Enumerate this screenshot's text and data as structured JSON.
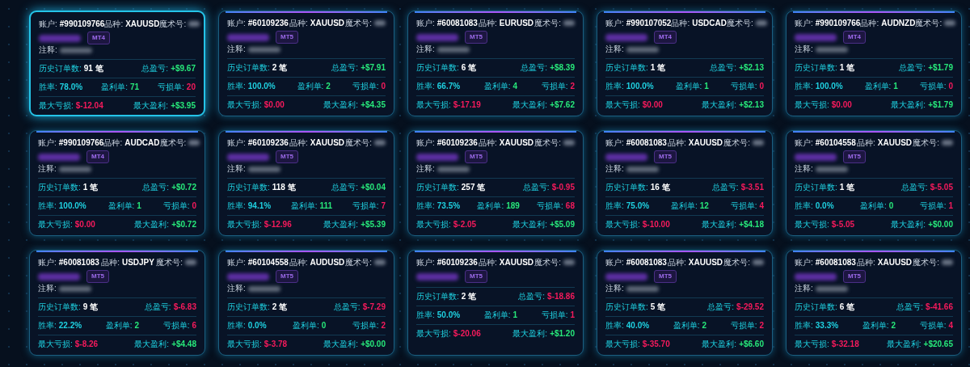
{
  "cards": [
    {
      "selected": true,
      "account": {
        "label": "账户:",
        "value": "#990109766"
      },
      "symbol": {
        "label": "品种:",
        "value": "XAUUSD"
      },
      "magic": {
        "label": "魔术号:"
      },
      "platform": "MT4",
      "comment": {
        "label": "注释:"
      },
      "orders": {
        "label": "历史订单数:",
        "value": "91 笔"
      },
      "total": {
        "label": "总盈亏:",
        "value": "+$9.67",
        "gain": true
      },
      "win_rate": {
        "label": "胜率:",
        "value": "78.0%"
      },
      "wins": {
        "label": "盈利单:",
        "value": "71"
      },
      "losses": {
        "label": "亏损单:",
        "value": "20"
      },
      "max_loss": {
        "label": "最大亏损:",
        "value": "$-12.04"
      },
      "max_profit": {
        "label": "最大盈利:",
        "value": "+$3.95"
      }
    },
    {
      "selected": false,
      "account": {
        "label": "账户:",
        "value": "#60109236"
      },
      "symbol": {
        "label": "品种:",
        "value": "XAUUSD"
      },
      "magic": {
        "label": "魔术号:"
      },
      "platform": "MT5",
      "comment": {
        "label": "注释:"
      },
      "orders": {
        "label": "历史订单数:",
        "value": "2 笔"
      },
      "total": {
        "label": "总盈亏:",
        "value": "+$7.91",
        "gain": true
      },
      "win_rate": {
        "label": "胜率:",
        "value": "100.0%"
      },
      "wins": {
        "label": "盈利单:",
        "value": "2"
      },
      "losses": {
        "label": "亏损单:",
        "value": "0"
      },
      "max_loss": {
        "label": "最大亏损:",
        "value": "$0.00"
      },
      "max_profit": {
        "label": "最大盈利:",
        "value": "+$4.35"
      }
    },
    {
      "selected": false,
      "account": {
        "label": "账户:",
        "value": "#60081083"
      },
      "symbol": {
        "label": "品种:",
        "value": "EURUSD"
      },
      "magic": {
        "label": "魔术号:"
      },
      "platform": "MT5",
      "comment": {
        "label": "注释:"
      },
      "orders": {
        "label": "历史订单数:",
        "value": "6 笔"
      },
      "total": {
        "label": "总盈亏:",
        "value": "+$8.39",
        "gain": true
      },
      "win_rate": {
        "label": "胜率:",
        "value": "66.7%"
      },
      "wins": {
        "label": "盈利单:",
        "value": "4"
      },
      "losses": {
        "label": "亏损单:",
        "value": "2"
      },
      "max_loss": {
        "label": "最大亏损:",
        "value": "$-17.19"
      },
      "max_profit": {
        "label": "最大盈利:",
        "value": "+$7.62"
      }
    },
    {
      "selected": false,
      "account": {
        "label": "账户:",
        "value": "#990107052"
      },
      "symbol": {
        "label": "品种:",
        "value": "USDCAD"
      },
      "magic": {
        "label": "魔术号:"
      },
      "platform": "MT4",
      "comment": {
        "label": "注释:"
      },
      "orders": {
        "label": "历史订单数:",
        "value": "1 笔"
      },
      "total": {
        "label": "总盈亏:",
        "value": "+$2.13",
        "gain": true
      },
      "win_rate": {
        "label": "胜率:",
        "value": "100.0%"
      },
      "wins": {
        "label": "盈利单:",
        "value": "1"
      },
      "losses": {
        "label": "亏损单:",
        "value": "0"
      },
      "max_loss": {
        "label": "最大亏损:",
        "value": "$0.00"
      },
      "max_profit": {
        "label": "最大盈利:",
        "value": "+$2.13"
      }
    },
    {
      "selected": false,
      "account": {
        "label": "账户:",
        "value": "#990109766"
      },
      "symbol": {
        "label": "品种:",
        "value": "AUDNZD"
      },
      "magic": {
        "label": "魔术号:"
      },
      "platform": "MT4",
      "comment": {
        "label": "注释:"
      },
      "orders": {
        "label": "历史订单数:",
        "value": "1 笔"
      },
      "total": {
        "label": "总盈亏:",
        "value": "+$1.79",
        "gain": true
      },
      "win_rate": {
        "label": "胜率:",
        "value": "100.0%"
      },
      "wins": {
        "label": "盈利单:",
        "value": "1"
      },
      "losses": {
        "label": "亏损单:",
        "value": "0"
      },
      "max_loss": {
        "label": "最大亏损:",
        "value": "$0.00"
      },
      "max_profit": {
        "label": "最大盈利:",
        "value": "+$1.79"
      }
    },
    {
      "selected": false,
      "account": {
        "label": "账户:",
        "value": "#990109766"
      },
      "symbol": {
        "label": "品种:",
        "value": "AUDCAD"
      },
      "magic": {
        "label": "魔术号:"
      },
      "platform": "MT4",
      "comment": {
        "label": "注释:"
      },
      "orders": {
        "label": "历史订单数:",
        "value": "1 笔"
      },
      "total": {
        "label": "总盈亏:",
        "value": "+$0.72",
        "gain": true
      },
      "win_rate": {
        "label": "胜率:",
        "value": "100.0%"
      },
      "wins": {
        "label": "盈利单:",
        "value": "1"
      },
      "losses": {
        "label": "亏损单:",
        "value": "0"
      },
      "max_loss": {
        "label": "最大亏损:",
        "value": "$0.00"
      },
      "max_profit": {
        "label": "最大盈利:",
        "value": "+$0.72"
      }
    },
    {
      "selected": false,
      "account": {
        "label": "账户:",
        "value": "#60109236"
      },
      "symbol": {
        "label": "品种:",
        "value": "XAUUSD"
      },
      "magic": {
        "label": "魔术号:"
      },
      "platform": "MT5",
      "comment": {
        "label": "注释:"
      },
      "orders": {
        "label": "历史订单数:",
        "value": "118 笔"
      },
      "total": {
        "label": "总盈亏:",
        "value": "+$0.04",
        "gain": true
      },
      "win_rate": {
        "label": "胜率:",
        "value": "94.1%"
      },
      "wins": {
        "label": "盈利单:",
        "value": "111"
      },
      "losses": {
        "label": "亏损单:",
        "value": "7"
      },
      "max_loss": {
        "label": "最大亏损:",
        "value": "$-12.96"
      },
      "max_profit": {
        "label": "最大盈利:",
        "value": "+$5.39"
      }
    },
    {
      "selected": false,
      "account": {
        "label": "账户:",
        "value": "#60109236"
      },
      "symbol": {
        "label": "品种:",
        "value": "XAUUSD"
      },
      "magic": {
        "label": "魔术号:"
      },
      "platform": "MT5",
      "comment": {
        "label": "注释:"
      },
      "orders": {
        "label": "历史订单数:",
        "value": "257 笔"
      },
      "total": {
        "label": "总盈亏:",
        "value": "$-0.95",
        "gain": false
      },
      "win_rate": {
        "label": "胜率:",
        "value": "73.5%"
      },
      "wins": {
        "label": "盈利单:",
        "value": "189"
      },
      "losses": {
        "label": "亏损单:",
        "value": "68"
      },
      "max_loss": {
        "label": "最大亏损:",
        "value": "$-2.05"
      },
      "max_profit": {
        "label": "最大盈利:",
        "value": "+$5.09"
      }
    },
    {
      "selected": false,
      "account": {
        "label": "账户:",
        "value": "#60081083"
      },
      "symbol": {
        "label": "品种:",
        "value": "XAUUSD"
      },
      "magic": {
        "label": "魔术号:"
      },
      "platform": "MT5",
      "comment": {
        "label": "注释:"
      },
      "orders": {
        "label": "历史订单数:",
        "value": "16 笔"
      },
      "total": {
        "label": "总盈亏:",
        "value": "$-3.51",
        "gain": false
      },
      "win_rate": {
        "label": "胜率:",
        "value": "75.0%"
      },
      "wins": {
        "label": "盈利单:",
        "value": "12"
      },
      "losses": {
        "label": "亏损单:",
        "value": "4"
      },
      "max_loss": {
        "label": "最大亏损:",
        "value": "$-10.00"
      },
      "max_profit": {
        "label": "最大盈利:",
        "value": "+$4.18"
      }
    },
    {
      "selected": false,
      "account": {
        "label": "账户:",
        "value": "#60104558"
      },
      "symbol": {
        "label": "品种:",
        "value": "XAUUSD"
      },
      "magic": {
        "label": "魔术号:"
      },
      "platform": "MT5",
      "comment": {
        "label": "注释:"
      },
      "orders": {
        "label": "历史订单数:",
        "value": "1 笔"
      },
      "total": {
        "label": "总盈亏:",
        "value": "$-5.05",
        "gain": false
      },
      "win_rate": {
        "label": "胜率:",
        "value": "0.0%"
      },
      "wins": {
        "label": "盈利单:",
        "value": "0"
      },
      "losses": {
        "label": "亏损单:",
        "value": "1"
      },
      "max_loss": {
        "label": "最大亏损:",
        "value": "$-5.05"
      },
      "max_profit": {
        "label": "最大盈利:",
        "value": "+$0.00"
      }
    },
    {
      "selected": false,
      "account": {
        "label": "账户:",
        "value": "#60081083"
      },
      "symbol": {
        "label": "品种:",
        "value": "USDJPY"
      },
      "magic": {
        "label": "魔术号:"
      },
      "platform": "MT5",
      "comment": {
        "label": "注释:"
      },
      "orders": {
        "label": "历史订单数:",
        "value": "9 笔"
      },
      "total": {
        "label": "总盈亏:",
        "value": "$-6.83",
        "gain": false
      },
      "win_rate": {
        "label": "胜率:",
        "value": "22.2%"
      },
      "wins": {
        "label": "盈利单:",
        "value": "2"
      },
      "losses": {
        "label": "亏损单:",
        "value": "6"
      },
      "max_loss": {
        "label": "最大亏损:",
        "value": "$-8.26"
      },
      "max_profit": {
        "label": "最大盈利:",
        "value": "+$4.48"
      }
    },
    {
      "selected": false,
      "account": {
        "label": "账户:",
        "value": "#60104558"
      },
      "symbol": {
        "label": "品种:",
        "value": "AUDUSD"
      },
      "magic": {
        "label": "魔术号:"
      },
      "platform": "MT5",
      "comment": {
        "label": "注释:"
      },
      "orders": {
        "label": "历史订单数:",
        "value": "2 笔"
      },
      "total": {
        "label": "总盈亏:",
        "value": "$-7.29",
        "gain": false
      },
      "win_rate": {
        "label": "胜率:",
        "value": "0.0%"
      },
      "wins": {
        "label": "盈利单:",
        "value": "0"
      },
      "losses": {
        "label": "亏损单:",
        "value": "2"
      },
      "max_loss": {
        "label": "最大亏损:",
        "value": "$-3.78"
      },
      "max_profit": {
        "label": "最大盈利:",
        "value": "+$0.00"
      }
    },
    {
      "selected": false,
      "account": {
        "label": "账户:",
        "value": "#60109236"
      },
      "symbol": {
        "label": "品种:",
        "value": "XAUUSD"
      },
      "magic": {
        "label": "魔术号:"
      },
      "platform": "MT5",
      "orders": {
        "label": "历史订单数:",
        "value": "2 笔"
      },
      "total": {
        "label": "总盈亏:",
        "value": "$-18.86",
        "gain": false
      },
      "win_rate": {
        "label": "胜率:",
        "value": "50.0%"
      },
      "wins": {
        "label": "盈利单:",
        "value": "1"
      },
      "losses": {
        "label": "亏损单:",
        "value": "1"
      },
      "max_loss": {
        "label": "最大亏损:",
        "value": "$-20.06"
      },
      "max_profit": {
        "label": "最大盈利:",
        "value": "+$1.20"
      }
    },
    {
      "selected": false,
      "account": {
        "label": "账户:",
        "value": "#60081083"
      },
      "symbol": {
        "label": "品种:",
        "value": "XAUUSD"
      },
      "magic": {
        "label": "魔术号:"
      },
      "platform": "MT5",
      "comment": {
        "label": "注释:"
      },
      "orders": {
        "label": "历史订单数:",
        "value": "5 笔"
      },
      "total": {
        "label": "总盈亏:",
        "value": "$-29.52",
        "gain": false
      },
      "win_rate": {
        "label": "胜率:",
        "value": "40.0%"
      },
      "wins": {
        "label": "盈利单:",
        "value": "2"
      },
      "losses": {
        "label": "亏损单:",
        "value": "2"
      },
      "max_loss": {
        "label": "最大亏损:",
        "value": "$-35.70"
      },
      "max_profit": {
        "label": "最大盈利:",
        "value": "+$6.60"
      }
    },
    {
      "selected": false,
      "account": {
        "label": "账户:",
        "value": "#60081083"
      },
      "symbol": {
        "label": "品种:",
        "value": "XAUUSD"
      },
      "magic": {
        "label": "魔术号:"
      },
      "platform": "MT5",
      "comment": {
        "label": "注释:"
      },
      "orders": {
        "label": "历史订单数:",
        "value": "6 笔"
      },
      "total": {
        "label": "总盈亏:",
        "value": "$-41.66",
        "gain": false
      },
      "win_rate": {
        "label": "胜率:",
        "value": "33.3%"
      },
      "wins": {
        "label": "盈利单:",
        "value": "2"
      },
      "losses": {
        "label": "亏损单:",
        "value": "4"
      },
      "max_loss": {
        "label": "最大亏损:",
        "value": "$-32.18"
      },
      "max_profit": {
        "label": "最大盈利:",
        "value": "+$20.65"
      }
    }
  ]
}
